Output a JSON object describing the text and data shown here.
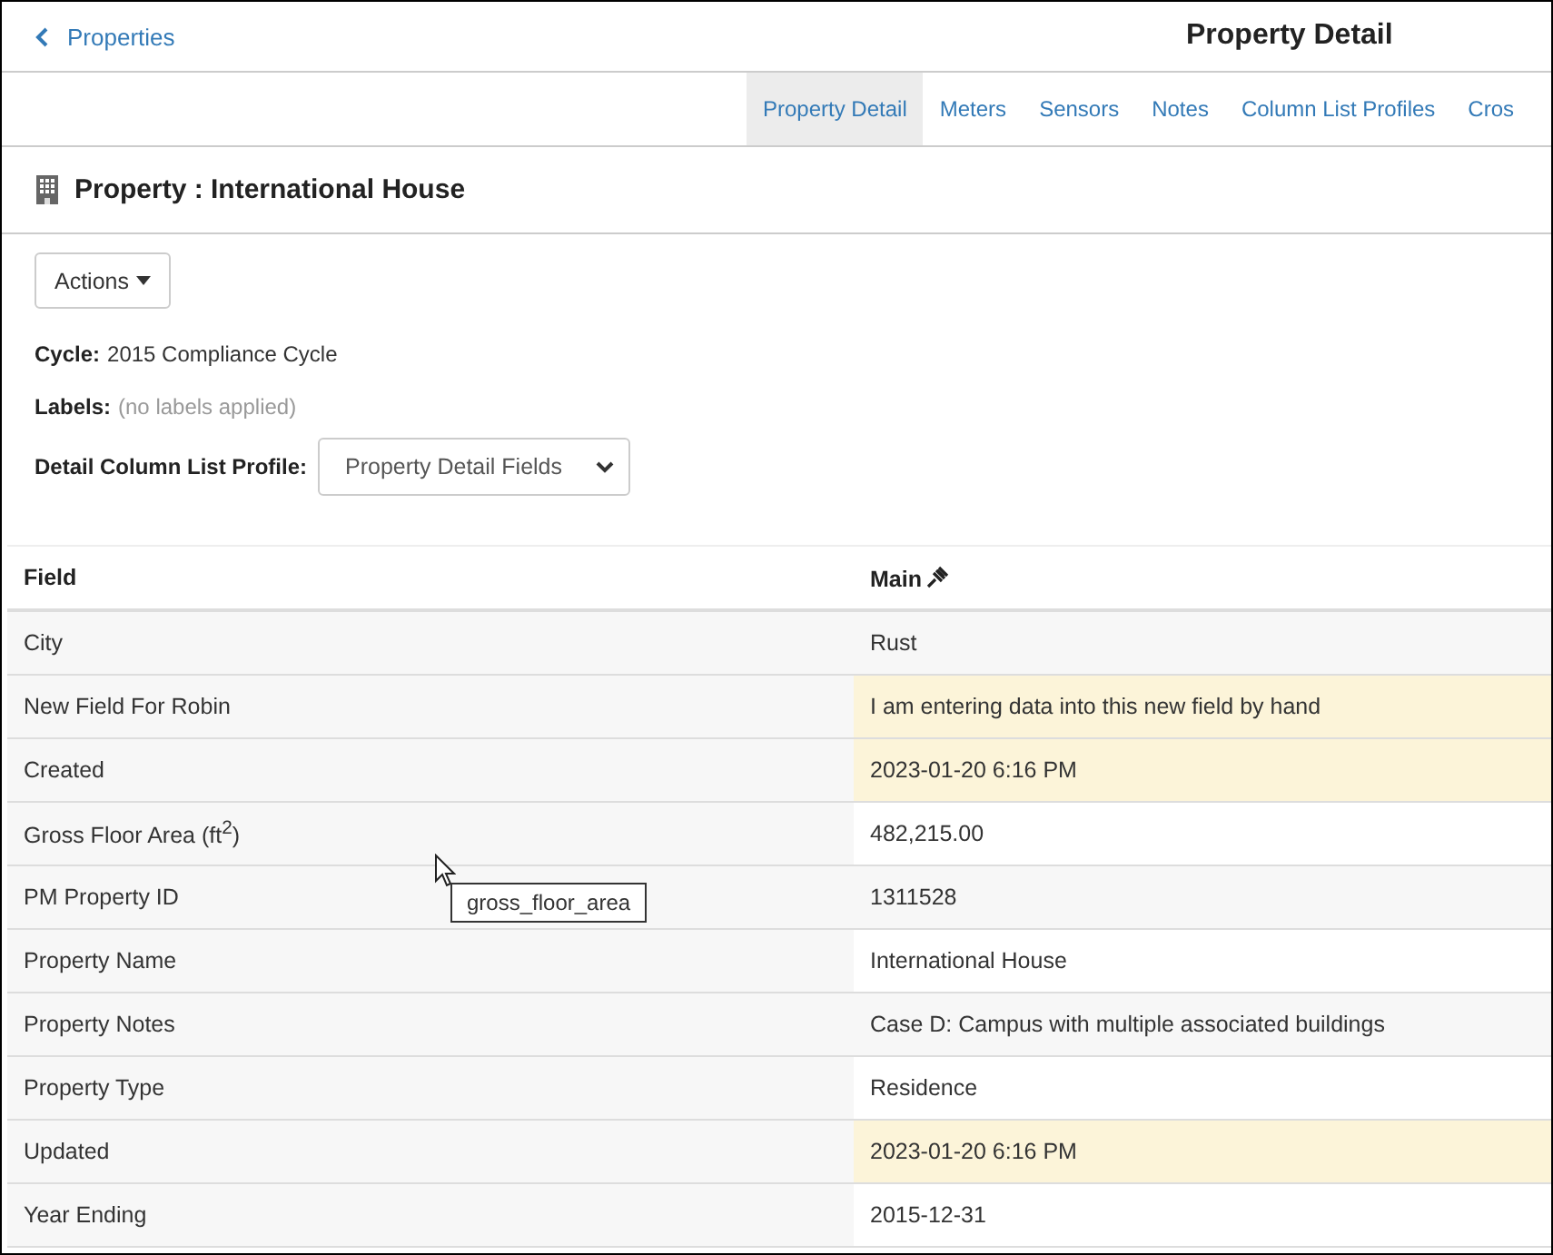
{
  "header": {
    "back_link": "Properties",
    "title": "Property Detail"
  },
  "tabs": [
    {
      "label": "Property Detail",
      "selected": true
    },
    {
      "label": "Meters",
      "selected": false
    },
    {
      "label": "Sensors",
      "selected": false
    },
    {
      "label": "Notes",
      "selected": false
    },
    {
      "label": "Column List Profiles",
      "selected": false
    },
    {
      "label": "Cros",
      "selected": false
    }
  ],
  "property_title": "Property : International House",
  "actions_button": "Actions",
  "cycle": {
    "label": "Cycle:",
    "value": "2015 Compliance Cycle"
  },
  "labels": {
    "label": "Labels:",
    "value": "(no labels applied)"
  },
  "profile": {
    "label": "Detail Column List Profile:",
    "value": "Property Detail Fields"
  },
  "table": {
    "columns": [
      "Field",
      "Main"
    ],
    "rows": [
      {
        "field": "City",
        "value": "Rust",
        "highlighted": false
      },
      {
        "field": "New Field For Robin",
        "value": "I am entering data into this new field by hand",
        "highlighted": true
      },
      {
        "field": "Created",
        "value": "2023-01-20 6:16 PM",
        "highlighted": true
      },
      {
        "field": "Gross Floor Area (ft$^{2}$)",
        "value": "482,215.00",
        "highlighted": false
      },
      {
        "field": "PM Property ID",
        "value": "1311528",
        "highlighted": false
      },
      {
        "field": "Property Name",
        "value": "International House",
        "highlighted": false
      },
      {
        "field": "Property Notes",
        "value": "Case D: Campus with multiple associated buildings",
        "highlighted": false
      },
      {
        "field": "Property Type",
        "value": "Residence",
        "highlighted": false
      },
      {
        "field": "Updated",
        "value": "2023-01-20 6:16 PM",
        "highlighted": true
      },
      {
        "field": "Year Ending",
        "value": "2015-12-31",
        "highlighted": false
      }
    ]
  },
  "tooltip": "gross_floor_area"
}
